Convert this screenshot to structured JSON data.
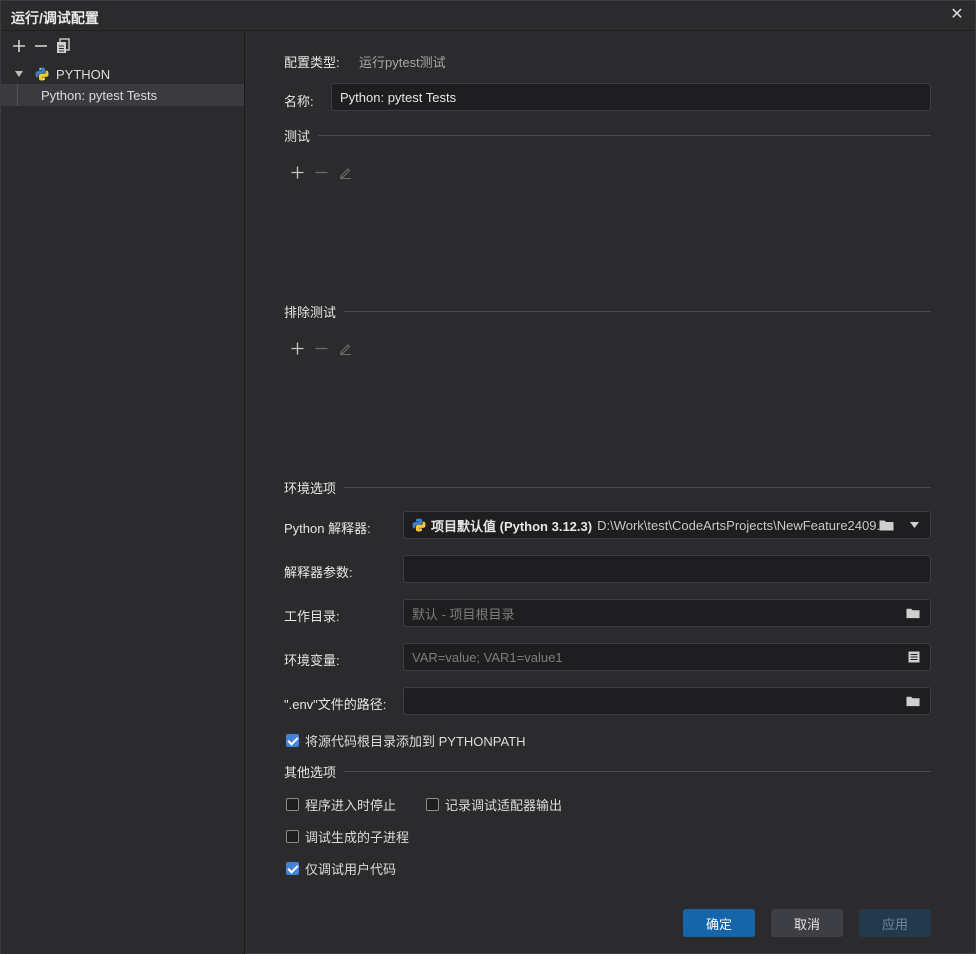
{
  "window": {
    "title": "运行/调试配置",
    "close_glyph": "✕"
  },
  "sidebar": {
    "group_label": "PYTHON",
    "selected_item": "Python: pytest Tests"
  },
  "config": {
    "type_label": "配置类型:",
    "type_value": "运行pytest测试",
    "name_label": "名称:",
    "name_value": "Python: pytest Tests"
  },
  "sections": {
    "tests": "测试",
    "excluded_tests": "排除测试",
    "env_options": "环境选项",
    "other_options": "其他选项"
  },
  "env": {
    "interpreter_label": "Python 解释器:",
    "interpreter_name": "项目默认值 (Python 3.12.3)",
    "interpreter_path": "D:\\Work\\test\\CodeArtsProjects\\NewFeature2409...",
    "interp_args_label": "解释器参数:",
    "interp_args_value": "",
    "workdir_label": "工作目录:",
    "workdir_placeholder": "默认 - 项目根目录",
    "envvars_label": "环境变量:",
    "envvars_placeholder": "VAR=value; VAR1=value1",
    "dotenv_label": "\".env\"文件的路径:",
    "dotenv_value": "",
    "add_source_roots_label": "将源代码根目录添加到 PYTHONPATH",
    "add_source_roots_checked": true
  },
  "other": {
    "stop_on_entry_label": "程序进入时停止",
    "stop_on_entry_checked": false,
    "log_adapter_label": "记录调试适配器输出",
    "log_adapter_checked": false,
    "debug_subprocess_label": "调试生成的子进程",
    "debug_subprocess_checked": false,
    "just_my_code_label": "仅调试用户代码",
    "just_my_code_checked": true
  },
  "buttons": {
    "ok": "确定",
    "cancel": "取消",
    "apply": "应用"
  },
  "colors": {
    "accent": "#3f84d6",
    "primary_button": "#1565a8",
    "background": "#2b2b2d"
  }
}
